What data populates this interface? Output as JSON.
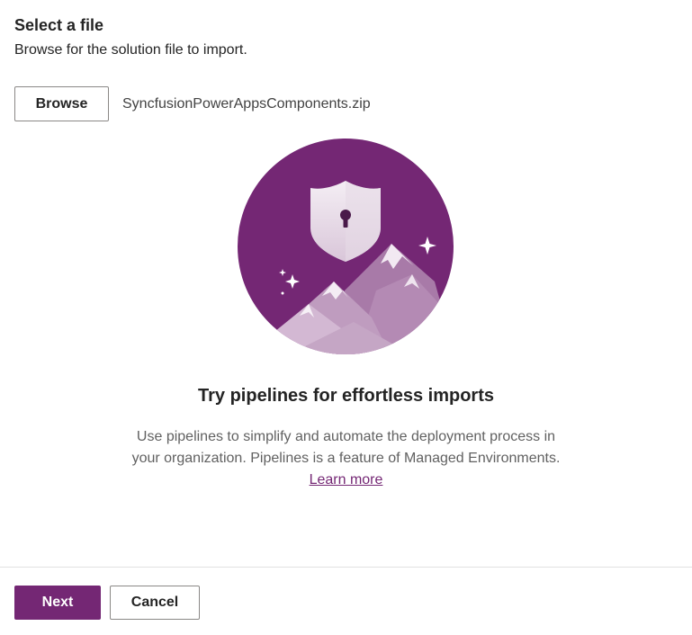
{
  "header": {
    "title": "Select a file",
    "description": "Browse for the solution file to import."
  },
  "file_picker": {
    "browse_label": "Browse",
    "selected_file": "SyncfusionPowerAppsComponents.zip"
  },
  "promo": {
    "illustration_icon": "shield-mountains-icon",
    "title": "Try pipelines for effortless imports",
    "description_line1": "Use pipelines to simplify and automate the deployment process in",
    "description_line2": "your organization. Pipelines is a feature of Managed Environments.",
    "link_label": "Learn more"
  },
  "footer": {
    "next_label": "Next",
    "cancel_label": "Cancel"
  },
  "colors": {
    "accent": "#742774",
    "border": "#8a8886",
    "text": "#242424",
    "muted_text": "#616161"
  }
}
